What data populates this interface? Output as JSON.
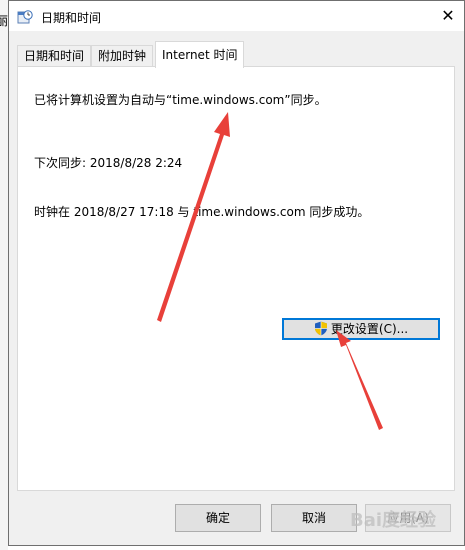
{
  "background": {
    "cut_text": "丽"
  },
  "window": {
    "title": "日期和时间",
    "close_glyph": "✕"
  },
  "tabs": [
    {
      "label": "日期和时间"
    },
    {
      "label": "附加时钟"
    },
    {
      "label": "Internet 时间",
      "active": true
    }
  ],
  "internet_time": {
    "sync_setting": "已将计算机设置为自动与“time.windows.com”同步。",
    "next_sync": "下次同步: 2018/8/28 2:24",
    "last_sync": "时钟在 2018/8/27 17:18 与 time.windows.com 同步成功。",
    "change_button": "更改设置(C)..."
  },
  "footer": {
    "ok": "确定",
    "cancel": "取消",
    "apply": "应用(A)"
  },
  "watermark": "Bai度经验",
  "colors": {
    "focus_border": "#0078d7",
    "annotation_arrow": "#e8403a",
    "dialog_bg": "#f0f0f0"
  },
  "icons": {
    "title": "datetime-clock-icon",
    "change_button": "uac-shield-icon",
    "close": "close-icon"
  }
}
